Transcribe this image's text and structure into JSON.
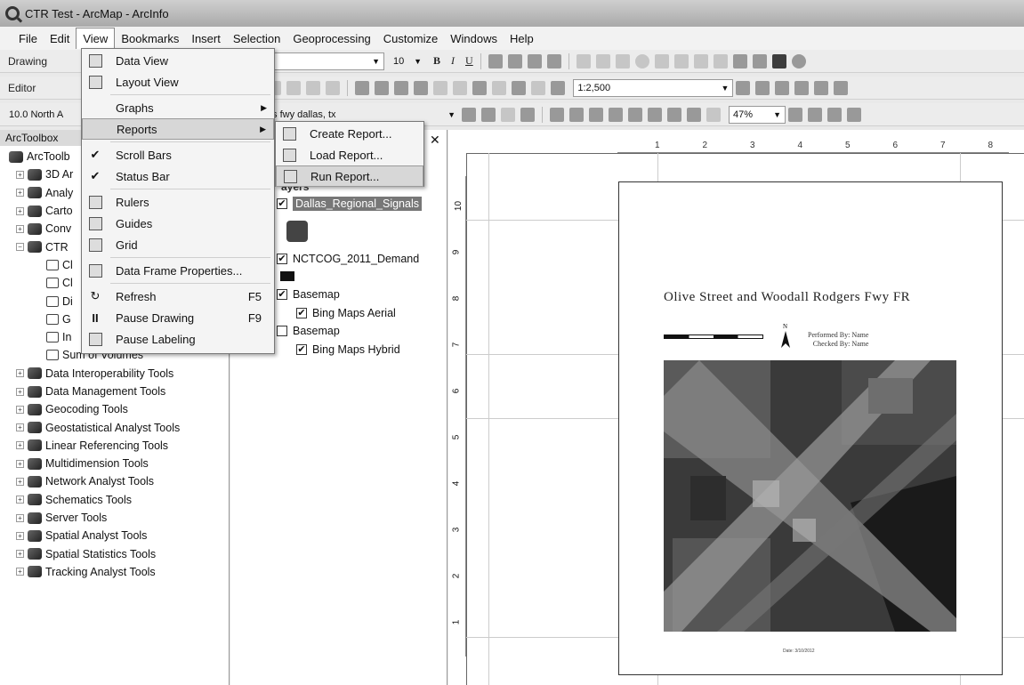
{
  "window": {
    "title": "CTR Test - ArcMap - ArcInfo"
  },
  "menubar": {
    "items": [
      "File",
      "Edit",
      "View",
      "Bookmarks",
      "Insert",
      "Selection",
      "Geoprocessing",
      "Customize",
      "Windows",
      "Help"
    ]
  },
  "toolbars": {
    "drawing_label": "Drawing",
    "font_name": "al",
    "font_size": "10",
    "bold": "B",
    "italic": "I",
    "underline": "U",
    "editor_label": "Editor",
    "scale_value": "1:2,500",
    "frame_value": "10.0 North A",
    "layer_value": "dgers fwy dallas, tx",
    "zoom_value": "47%"
  },
  "toolbox": {
    "header": "ArcToolbox",
    "items": [
      {
        "label": "ArcToolb",
        "level": 0,
        "kind": "root"
      },
      {
        "label": "3D Ar",
        "level": 1,
        "kind": "box"
      },
      {
        "label": "Analy",
        "level": 1,
        "kind": "box"
      },
      {
        "label": "Carto",
        "level": 1,
        "kind": "box"
      },
      {
        "label": "Conv",
        "level": 1,
        "kind": "box"
      },
      {
        "label": "CTR",
        "level": 1,
        "kind": "box-open"
      },
      {
        "label": "Cl",
        "level": 2,
        "kind": "tool"
      },
      {
        "label": "Cl",
        "level": 2,
        "kind": "tool"
      },
      {
        "label": "Di",
        "level": 2,
        "kind": "tool"
      },
      {
        "label": "G",
        "level": 2,
        "kind": "tool"
      },
      {
        "label": "In",
        "level": 2,
        "kind": "tool"
      },
      {
        "label": "Sum of Volumes",
        "level": 2,
        "kind": "tool"
      },
      {
        "label": "Data Interoperability Tools",
        "level": 1,
        "kind": "box"
      },
      {
        "label": "Data Management Tools",
        "level": 1,
        "kind": "box"
      },
      {
        "label": "Geocoding Tools",
        "level": 1,
        "kind": "box"
      },
      {
        "label": "Geostatistical Analyst Tools",
        "level": 1,
        "kind": "box"
      },
      {
        "label": "Linear Referencing Tools",
        "level": 1,
        "kind": "box"
      },
      {
        "label": "Multidimension Tools",
        "level": 1,
        "kind": "box"
      },
      {
        "label": "Network Analyst Tools",
        "level": 1,
        "kind": "box"
      },
      {
        "label": "Schematics Tools",
        "level": 1,
        "kind": "box"
      },
      {
        "label": "Server Tools",
        "level": 1,
        "kind": "box"
      },
      {
        "label": "Spatial Analyst Tools",
        "level": 1,
        "kind": "box"
      },
      {
        "label": "Spatial Statistics Tools",
        "level": 1,
        "kind": "box"
      },
      {
        "label": "Tracking Analyst Tools",
        "level": 1,
        "kind": "box"
      }
    ]
  },
  "toc": {
    "layers_partial": "ayers",
    "signals_layer": "Dallas_Regional_Signals",
    "demand_layer": "NCTCOG_2011_Demand",
    "basemap1": "Basemap",
    "basemap1_child": "Bing Maps Aerial",
    "basemap2": "Basemap",
    "basemap2_child": "Bing Maps Hybrid"
  },
  "view_menu": {
    "data_view": "Data View",
    "layout_view": "Layout View",
    "graphs": "Graphs",
    "reports": "Reports",
    "scroll_bars": "Scroll Bars",
    "status_bar": "Status Bar",
    "rulers": "Rulers",
    "guides": "Guides",
    "grid": "Grid",
    "data_frame_properties": "Data Frame Properties...",
    "refresh": "Refresh",
    "refresh_shortcut": "F5",
    "pause_drawing": "Pause Drawing",
    "pause_drawing_shortcut": "F9",
    "pause_labeling": "Pause Labeling"
  },
  "reports_menu": {
    "create": "Create Report...",
    "load": "Load Report...",
    "run": "Run Report..."
  },
  "layout": {
    "map_title": "Olive Street and Woodall Rodgers Fwy FR",
    "performed_by": "Performed By:   Name",
    "checked_by": "Checked By:   Name",
    "date_label": "Date: 3/10/2012",
    "north_label": "N",
    "ruler_top": [
      "1",
      "2",
      "3",
      "4",
      "5",
      "6",
      "7",
      "8"
    ],
    "ruler_left": [
      "10",
      "9",
      "8",
      "7",
      "6",
      "5",
      "4",
      "3",
      "2",
      "1"
    ]
  }
}
